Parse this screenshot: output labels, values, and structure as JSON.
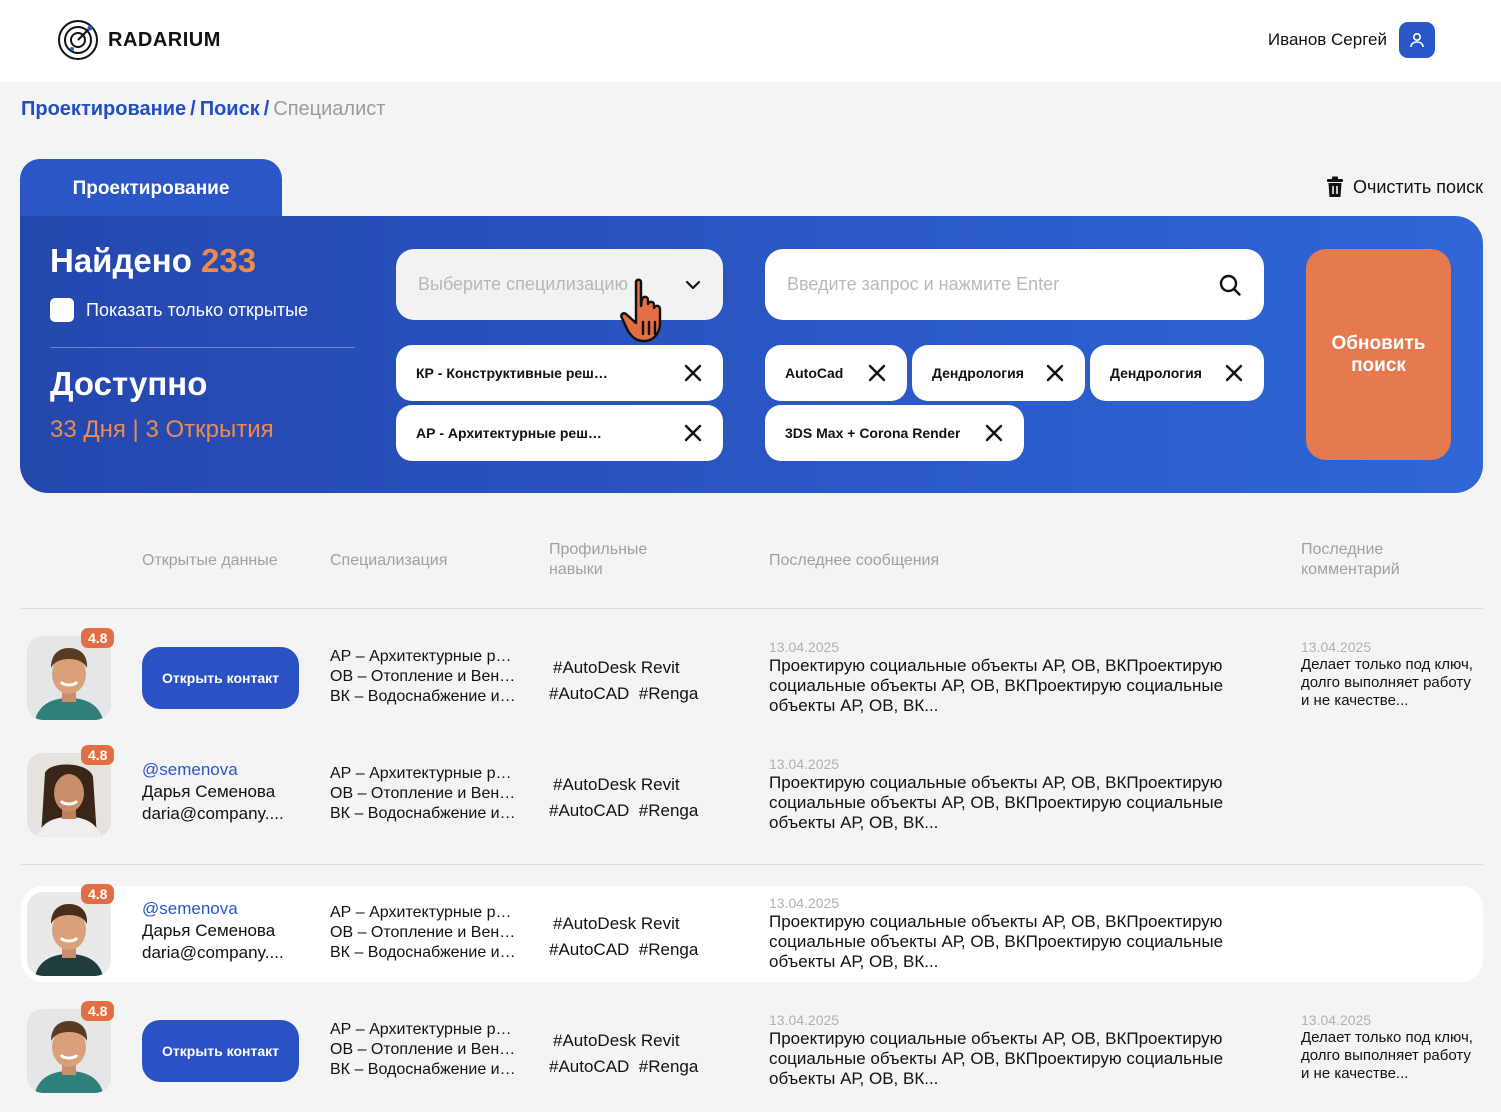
{
  "app": {
    "logo_text": "RADARIUM"
  },
  "user": {
    "name": "Иванов Сергей"
  },
  "breadcrumb": {
    "items": [
      "Проектирование",
      "Поиск"
    ],
    "current": "Специалист"
  },
  "tab": {
    "label": "Проектирование"
  },
  "clear_search": {
    "label": "Очистить поиск"
  },
  "summary": {
    "found_label": "Найдено",
    "found_count": "233",
    "show_open_only": "Показать только открытые",
    "available_label": "Доступно",
    "available_sub": "33 Дня | 3 Открытия"
  },
  "filters": {
    "specialization_placeholder": "Выберите специлизацию",
    "search_placeholder": "Введите запрос и нажмите Enter",
    "spec_chips": [
      "КР - Конструктивные решения",
      "АР - Архитектурные решения"
    ],
    "skill_chips": [
      "AutoCad",
      "Дендрология",
      "Дендрология",
      "3DS Max + Corona Render"
    ],
    "refresh_label": "Обновить поиск"
  },
  "table": {
    "headers": {
      "open_data": "Открытые данные",
      "specialization": "Специализация",
      "skills": "Профильные навыки",
      "last_message": "Последнее сообщения",
      "last_comment": "Последние комментарий"
    },
    "rows": [
      {
        "rating": "4.8",
        "open_contact": "Открыть контакт",
        "spec": [
          "АР – Архитектурные решения",
          "ОВ – Отопление и Вентиляция",
          "ВК – Водоснабжение и канализация"
        ],
        "skills_line1": "#AutoDesk Revit",
        "skills_line2": "#AutoCAD  #Renga",
        "msg_date": "13.04.2025",
        "msg": "Проектирую социальные объекты АР, ОВ, ВКПроектирую социальные объекты АР, ОВ, ВКПроектирую социальные объекты АР, ОВ, ВК...",
        "comment_date": "13.04.2025",
        "comment": "Делает только под ключ, долго выполняет работу и не качестве..."
      },
      {
        "rating": "4.8",
        "handle": "@semenova",
        "name": "Дарья Семенова",
        "email": "daria@company....",
        "spec": [
          "АР – Архитектурные решения",
          "ОВ – Отопление и Вентиляция",
          "ВК – Водоснабжение и канализация"
        ],
        "skills_line1": "#AutoDesk Revit",
        "skills_line2": "#AutoCAD  #Renga",
        "msg_date": "13.04.2025",
        "msg": "Проектирую социальные объекты АР, ОВ, ВКПроектирую социальные объекты АР, ОВ, ВКПроектирую социальные объекты АР, ОВ, ВК..."
      },
      {
        "rating": "4.8",
        "handle": "@semenova",
        "name": "Дарья Семенова",
        "email": "daria@company....",
        "spec": [
          "АР – Архитектурные решения",
          "ОВ – Отопление и Вентиляция",
          "ВК – Водоснабжение и канализация"
        ],
        "skills_line1": "#AutoDesk Revit",
        "skills_line2": "#AutoCAD  #Renga",
        "msg_date": "13.04.2025",
        "msg": "Проектирую социальные объекты АР, ОВ, ВКПроектирую социальные объекты АР, ОВ, ВКПроектирую социальные объекты АР, ОВ, ВК..."
      },
      {
        "rating": "4.8",
        "open_contact": "Открыть контакт",
        "spec": [
          "АР – Архитектурные решения",
          "ОВ – Отопление и Вентиляция",
          "ВК – Водоснабжение и канализация"
        ],
        "skills_line1": "#AutoDesk Revit",
        "skills_line2": "#AutoCAD  #Renga",
        "msg_date": "13.04.2025",
        "msg": "Проектирую социальные объекты АР, ОВ, ВКПроектирую социальные объекты АР, ОВ, ВКПроектирую социальные объекты АР, ОВ, ВК...",
        "comment_date": "13.04.2025",
        "comment": "Делает только под ключ, долго выполняет работу и не качестве..."
      }
    ]
  },
  "colors": {
    "brand_blue": "#2a56c6",
    "accent_orange": "#e57a4f",
    "rating_badge": "#e36e43"
  }
}
